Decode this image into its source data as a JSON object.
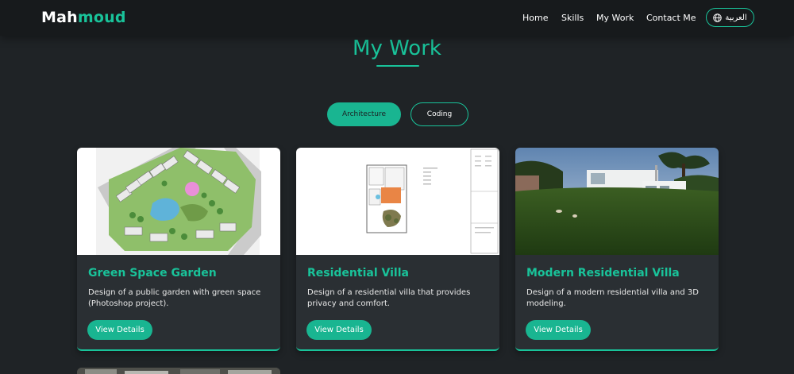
{
  "header": {
    "logo_part1": "Mah",
    "logo_part2": "moud",
    "nav": [
      "Home",
      "Skills",
      "My Work",
      "Contact Me"
    ],
    "language_button": "العربية",
    "language_icon": "globe-icon"
  },
  "section": {
    "title": "My Work"
  },
  "tabs": [
    {
      "label": "Architecture",
      "active": true
    },
    {
      "label": "Coding",
      "active": false
    }
  ],
  "cards": [
    {
      "title": "Green Space Garden",
      "description": "Design of a public garden with green space (Photoshop project).",
      "button": "View Details"
    },
    {
      "title": "Residential Villa",
      "description": "Design of a residential villa that provides privacy and comfort.",
      "button": "View Details"
    },
    {
      "title": "Modern Residential Villa",
      "description": "Design of a modern residential villa and 3D modeling.",
      "button": "View Details"
    }
  ],
  "colors": {
    "accent": "#19c39a",
    "background": "#1f2326",
    "navbar": "#171a1c",
    "card": "#2a2f33"
  }
}
